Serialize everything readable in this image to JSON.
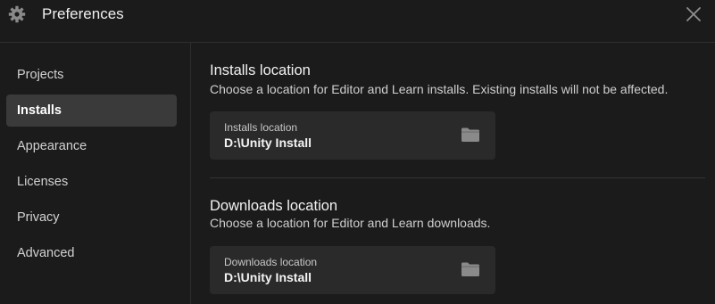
{
  "window": {
    "title": "Preferences",
    "title_icon": "gear-icon",
    "close_icon": "close-icon"
  },
  "sidebar": {
    "items": [
      {
        "label": "Projects",
        "active": false
      },
      {
        "label": "Installs",
        "active": true
      },
      {
        "label": "Appearance",
        "active": false
      },
      {
        "label": "Licenses",
        "active": false
      },
      {
        "label": "Privacy",
        "active": false
      },
      {
        "label": "Advanced",
        "active": false
      }
    ]
  },
  "main": {
    "installs": {
      "title": "Installs location",
      "description": "Choose a location for Editor and Learn installs. Existing installs will not be affected.",
      "field_label": "Installs location",
      "field_value": "D:\\Unity Install",
      "icon": "folder-icon"
    },
    "downloads": {
      "title": "Downloads location",
      "description": "Choose a location for Editor and Learn downloads.",
      "field_label": "Downloads location",
      "field_value": "D:\\Unity Install",
      "icon": "folder-icon"
    }
  },
  "colors": {
    "background": "#1b1b1b",
    "card": "#2a2a2a",
    "active_item": "#3a3a3a",
    "icon": "#8a8a8a"
  }
}
